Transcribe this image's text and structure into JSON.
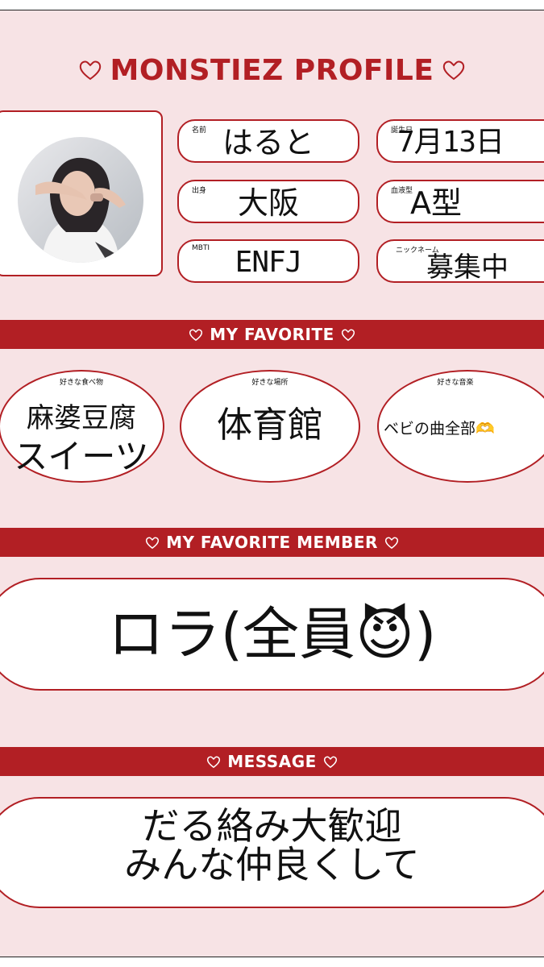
{
  "title": "MONSTIEZ PROFILE",
  "profile": {
    "name": {
      "label": "名前",
      "value": "はると"
    },
    "birthday": {
      "label": "誕生日",
      "value": "7月13日"
    },
    "hometown": {
      "label": "出身",
      "value": "大阪"
    },
    "blood": {
      "label": "血液型",
      "value": "A型"
    },
    "mbti": {
      "label": "MBTI",
      "value": "ENFJ"
    },
    "nickname": {
      "label": "ニックネーム",
      "value": "募集中"
    }
  },
  "favorite": {
    "heading": "MY FAVORITE",
    "food": {
      "label": "好きな食べ物",
      "line1": "麻婆豆腐",
      "line2": "スイーツ"
    },
    "place": {
      "label": "好きな場所",
      "value": "体育館"
    },
    "music": {
      "label": "好きな音楽",
      "value": "ベビの曲全部🫶"
    }
  },
  "member": {
    "heading": "MY FAVORITE MEMBER",
    "value": "ロラ(全員😈)"
  },
  "message": {
    "heading": "MESSAGE",
    "line1": "だる絡み大歓迎",
    "line2": "みんな仲良くして"
  },
  "colors": {
    "accent": "#b21f24",
    "background": "#f7e3e5"
  }
}
